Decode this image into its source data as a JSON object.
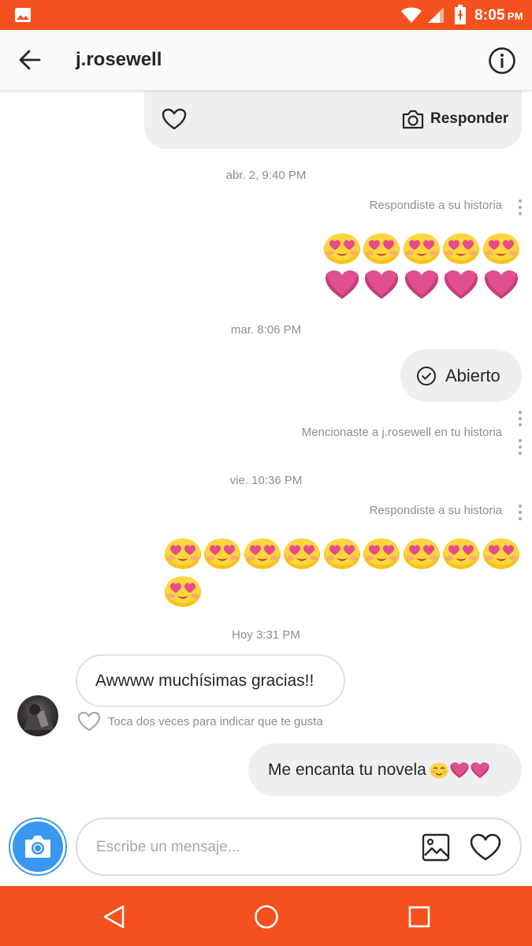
{
  "status_bar": {
    "time": "8:05",
    "ampm": "PM",
    "bg_color": "#f4511e",
    "icons": [
      "gallery-icon",
      "wifi-icon",
      "signal-icon",
      "battery-charging-icon"
    ]
  },
  "header": {
    "username": "j.rosewell",
    "icons": [
      "back-arrow-icon",
      "info-icon"
    ]
  },
  "story_card": {
    "reply_label": "Responder",
    "icons": [
      "heart-outline-icon",
      "camera-icon"
    ]
  },
  "messages": {
    "ts1": "abr. 2, 9:40 PM",
    "note1": "Respondiste a su historia",
    "reply1_emojis": [
      "heart-eyes-emoji",
      "heart-eyes-emoji",
      "heart-eyes-emoji",
      "heart-eyes-emoji",
      "heart-eyes-emoji",
      "pink-heart-emoji",
      "pink-heart-emoji",
      "pink-heart-emoji",
      "pink-heart-emoji",
      "pink-heart-emoji"
    ],
    "ts2": "mar. 8:06 PM",
    "opened_label": "Abierto",
    "note2": "Mencionaste a j.rosewell en tu historia",
    "ts3": "vie. 10:36 PM",
    "note3": "Respondiste a su historia",
    "reply3_emoji_count": 10,
    "reply3_emoji": "heart-eyes-emoji",
    "ts4": "Hoy 3:31 PM",
    "incoming_text": "Awwww muchísimas gracias!!",
    "like_hint": "Toca dos veces para indicar que te gusta",
    "outgoing_text": "Me encanta tu novela",
    "outgoing_emojis": [
      "smiling-blush-emoji",
      "pink-heart-emoji",
      "pink-heart-emoji"
    ]
  },
  "composer": {
    "placeholder": "Escribe un mensaje...",
    "icons": [
      "camera-icon",
      "gallery-icon",
      "heart-outline-icon"
    ],
    "accent_color": "#3897f0"
  },
  "nav_bar": {
    "buttons": [
      "back-triangle-icon",
      "home-circle-icon",
      "recents-square-icon"
    ]
  }
}
